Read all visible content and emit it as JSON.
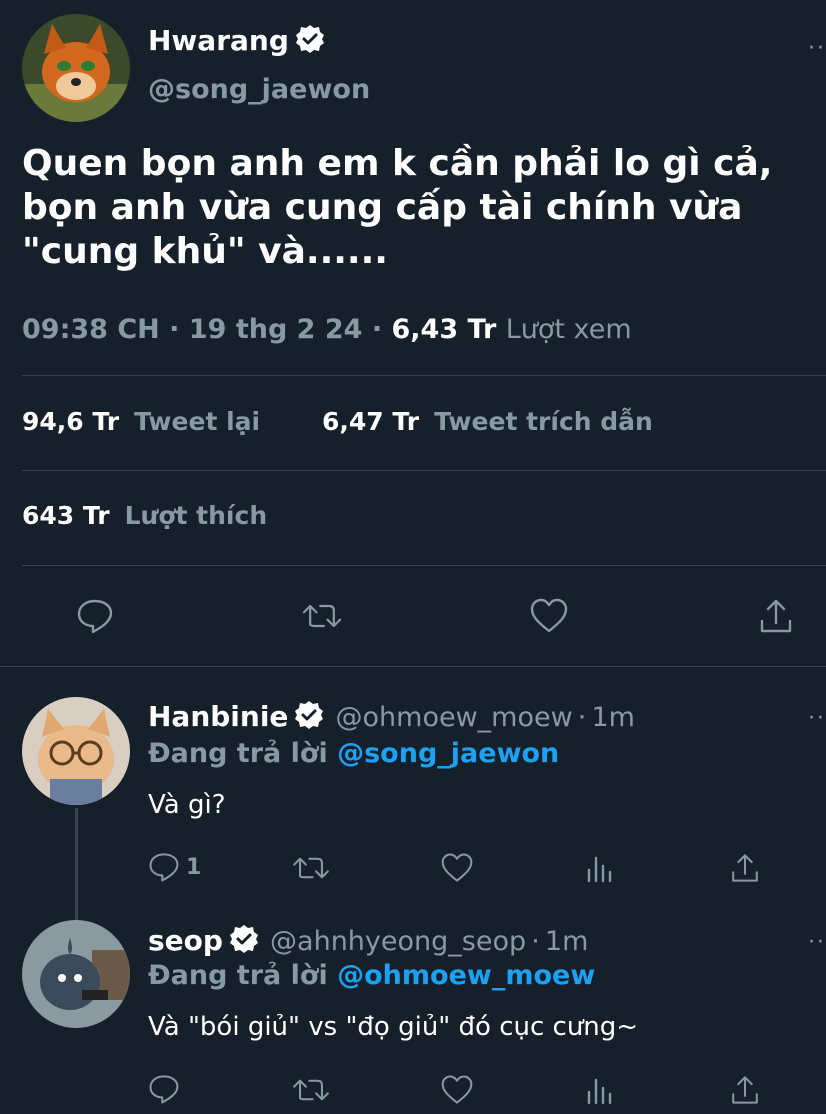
{
  "main_tweet": {
    "display_name": "Hwarang",
    "handle": "@song_jaewon",
    "text_lines": [
      "Quen bọn anh em k cần phải lo gì cả,",
      "bọn anh vừa cung cấp tài chính vừa",
      "\"cung khủ\" và......"
    ],
    "time": "09:38 CH",
    "date": "19 thg 2 24",
    "views_count": "6,43 Tr",
    "views_label": "Lượt xem",
    "retweets_count": "94,6 Tr",
    "retweets_label": "Tweet lại",
    "quotes_count": "6,47 Tr",
    "quotes_label": "Tweet trích dẫn",
    "likes_count": "643 Tr",
    "likes_label": "Lượt thích"
  },
  "replies": [
    {
      "display_name": "Hanbinie",
      "handle": "@ohmoew_moew",
      "time_ago": "1m",
      "replying_prefix": "Đang trả lời",
      "replying_to": "@song_jaewon",
      "text": "Và gì?",
      "reply_count": "1"
    },
    {
      "display_name": "seop",
      "handle": "@ahnhyeong_seop",
      "time_ago": "1m",
      "replying_prefix": "Đang trả lời",
      "replying_to": "@ohmoew_moew",
      "text": "Và \"bói giủ\" vs \"đọ giủ\" đó cục cưng~",
      "reply_count": ""
    }
  ],
  "separator_dot": "·",
  "colors": {
    "background": "#15202b",
    "secondary_text": "#8899a6",
    "accent": "#1da1f2",
    "divider": "#38444d"
  },
  "icons": [
    "reply-icon",
    "retweet-icon",
    "like-icon",
    "share-icon",
    "analytics-icon",
    "verified-icon",
    "more-icon"
  ]
}
